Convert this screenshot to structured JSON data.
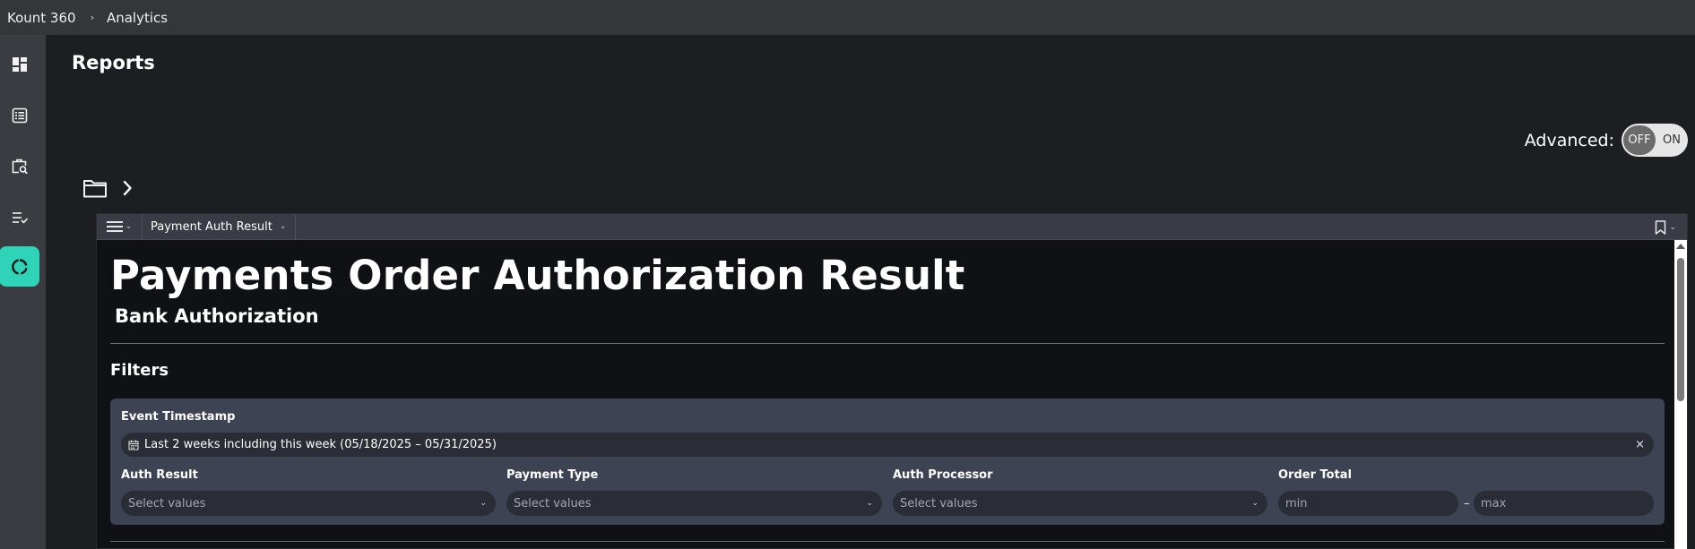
{
  "topbar": {
    "app_name": "Kount 360",
    "separator": "›",
    "section": "Analytics"
  },
  "rail": {
    "items": [
      {
        "icon": "dashboard-icon"
      },
      {
        "icon": "list-icon"
      },
      {
        "icon": "case-search-icon"
      },
      {
        "icon": "checklist-icon"
      },
      {
        "icon": "analytics-donut-icon",
        "active": true
      }
    ],
    "active_color": "#2fd4b8"
  },
  "page": {
    "title": "Reports",
    "advanced_label": "Advanced:",
    "toggle_off": "OFF",
    "toggle_on": "ON"
  },
  "report": {
    "tab_label": "Payment Auth Result",
    "title": "Payments Order Authorization Result",
    "subtitle": "Bank Authorization",
    "filters_heading": "Filters",
    "filters": {
      "event_timestamp_label": "Event Timestamp",
      "event_timestamp_value": "Last 2 weeks including this week (05/18/2025 – 05/31/2025)",
      "clear_symbol": "×",
      "auth_result_label": "Auth Result",
      "auth_result_placeholder": "Select values",
      "payment_type_label": "Payment Type",
      "payment_type_placeholder": "Select values",
      "auth_processor_label": "Auth Processor",
      "auth_processor_placeholder": "Select values",
      "order_total_label": "Order Total",
      "order_total_min": "min",
      "order_total_max": "max",
      "range_dash": "–"
    }
  },
  "colors": {
    "topbar_bg": "#35363a",
    "rail_bg": "#3a3c41",
    "panel_bg": "#3d4352"
  }
}
